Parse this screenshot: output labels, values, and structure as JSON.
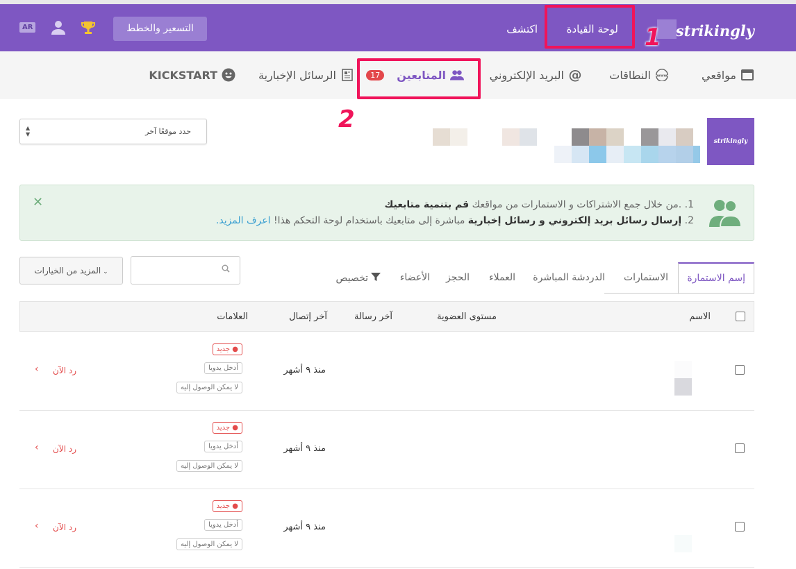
{
  "topbar": {
    "brand": "strikingly",
    "nav_dashboard": "لوحة القيادة",
    "nav_explore": "اكتشف",
    "pricing_button": "التسعير والخطط",
    "language_badge": "AR",
    "accent": "#7e57c2"
  },
  "subnav": {
    "items": [
      {
        "label": "مواقعي",
        "icon": "window-icon"
      },
      {
        "label": "النطاقات",
        "icon": "www-icon"
      },
      {
        "label": "البريد الإلكتروني",
        "icon": "at-icon"
      },
      {
        "label": "المتابعين",
        "icon": "users-icon",
        "count": "17"
      },
      {
        "label": "الرسائل الإخبارية",
        "icon": "newsletter-icon"
      },
      {
        "label": "KICKSTART",
        "icon": "smiley-icon"
      }
    ]
  },
  "annotations": {
    "one": "1",
    "two": "2",
    "color": "#f0145a"
  },
  "site_selector": {
    "label": "حدد موقعًا آخر"
  },
  "site_thumb": {
    "label": "strikingly"
  },
  "alert": {
    "line1_num": "1.",
    "line1_text": ".من خلال جمع الاشتراكات و الاستمارات من مواقعك",
    "line1_bold": "قم بتنمية متابعيك",
    "line2_num": "2.",
    "line2_bold": "إرسال رسائل بريد إلكتروني و رسائل إخبارية",
    "line2_text": "مباشرة إلى متابعيك باستخدام لوحة التحكم هذا!",
    "line2_link": "اعرف المزيد."
  },
  "toolbar": {
    "more_options": "المزيد من الخيارات"
  },
  "tabs": {
    "items": [
      "إسم الاستمارة",
      "الاستمارات",
      "الدردشة المباشرة",
      "العملاء",
      "الحجز",
      "الأعضاء",
      "تخصيص"
    ]
  },
  "table": {
    "headers": {
      "name": "الاسم",
      "membership": "مستوى العضوية",
      "last_message": "آخر رسالة",
      "last_contact": "آخر إتصال",
      "tags": "العلامات"
    },
    "rows": [
      {
        "last_contact": "منذ ٩ أشهر",
        "tag_new": "جديد",
        "tag_manual": "أدخل يدويا",
        "tag_unreachable": "لا يمكن الوصول إليه",
        "reply": "رد الآن"
      },
      {
        "last_contact": "منذ ٩ أشهر",
        "tag_new": "جديد",
        "tag_manual": "أدخل يدويا",
        "tag_unreachable": "لا يمكن الوصول إليه",
        "reply": "رد الآن"
      },
      {
        "last_contact": "منذ ٩ أشهر",
        "tag_new": "جديد",
        "tag_manual": "أدخل يدويا",
        "tag_unreachable": "لا يمكن الوصول إليه",
        "reply": "رد الآن"
      }
    ]
  }
}
